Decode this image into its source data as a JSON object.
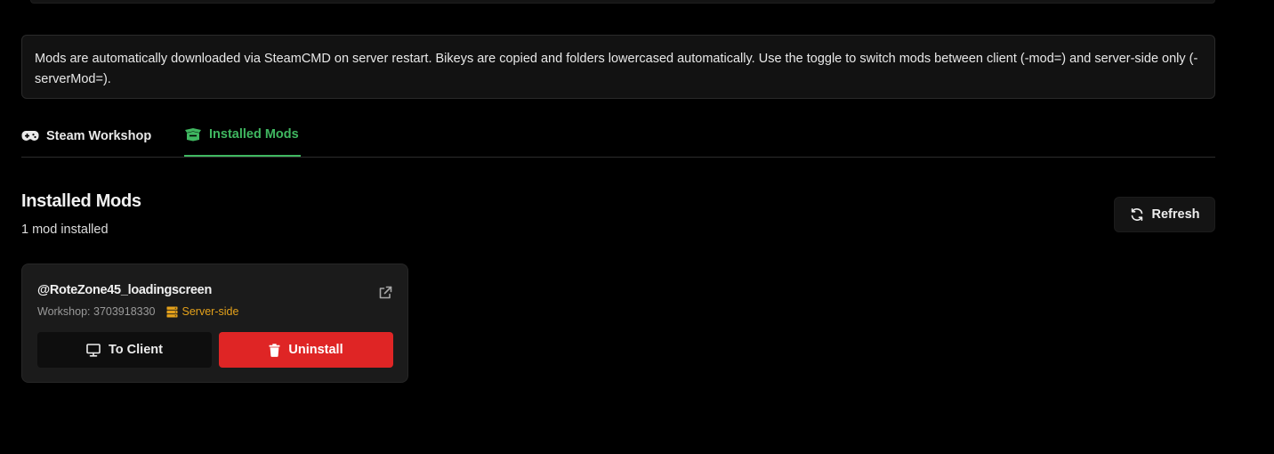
{
  "info": {
    "text": "Mods are automatically downloaded via SteamCMD on server restart. Bikeys are copied and folders lowercased automatically. Use the toggle to switch mods between client (-mod=) and server-side only (-serverMod=)."
  },
  "tabs": [
    {
      "label": "Steam Workshop",
      "icon": "gamepad-icon",
      "active": false
    },
    {
      "label": "Installed Mods",
      "icon": "box-icon",
      "active": true
    }
  ],
  "section": {
    "title": "Installed Mods",
    "subtitle": "1 mod installed",
    "refresh_label": "Refresh"
  },
  "mods": [
    {
      "name": "@RoteZone45_loadingscreen",
      "workshop": "Workshop: 3703918330",
      "badge": "Server-side",
      "to_client_label": "To Client",
      "uninstall_label": "Uninstall"
    }
  ],
  "colors": {
    "accent": "#3fb760",
    "danger": "#df2525",
    "warning": "#e4a11b",
    "background": "#000000"
  }
}
